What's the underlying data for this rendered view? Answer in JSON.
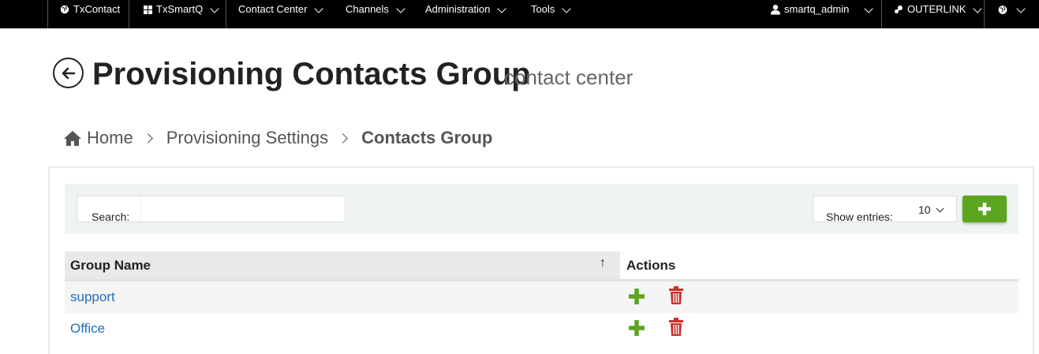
{
  "nav": {
    "txcontact": "TxContact",
    "txsmartq": "TxSmartQ",
    "contact_center": "Contact Center",
    "channels": "Channels",
    "administration": "Administration",
    "tools": "Tools",
    "user": "smartq_admin",
    "outerlink": "OUTERLINK"
  },
  "header": {
    "title": "Provisioning Contacts Group",
    "subtitle": "contact center"
  },
  "breadcrumb": {
    "home": "Home",
    "settings": "Provisioning Settings",
    "current": "Contacts Group"
  },
  "toolbar": {
    "search_label": "Search:",
    "search_value": "",
    "entries_label": "Show entries:",
    "entries_value": "10"
  },
  "table": {
    "col_group": "Group Name",
    "col_actions": "Actions",
    "sort_indicator": "↑",
    "rows": [
      {
        "name": "support"
      },
      {
        "name": "Office"
      }
    ]
  },
  "colors": {
    "nav_bg": "#000000",
    "add_green": "#5ca520",
    "delete_red": "#c9302c",
    "link_blue": "#1f6fbf"
  }
}
